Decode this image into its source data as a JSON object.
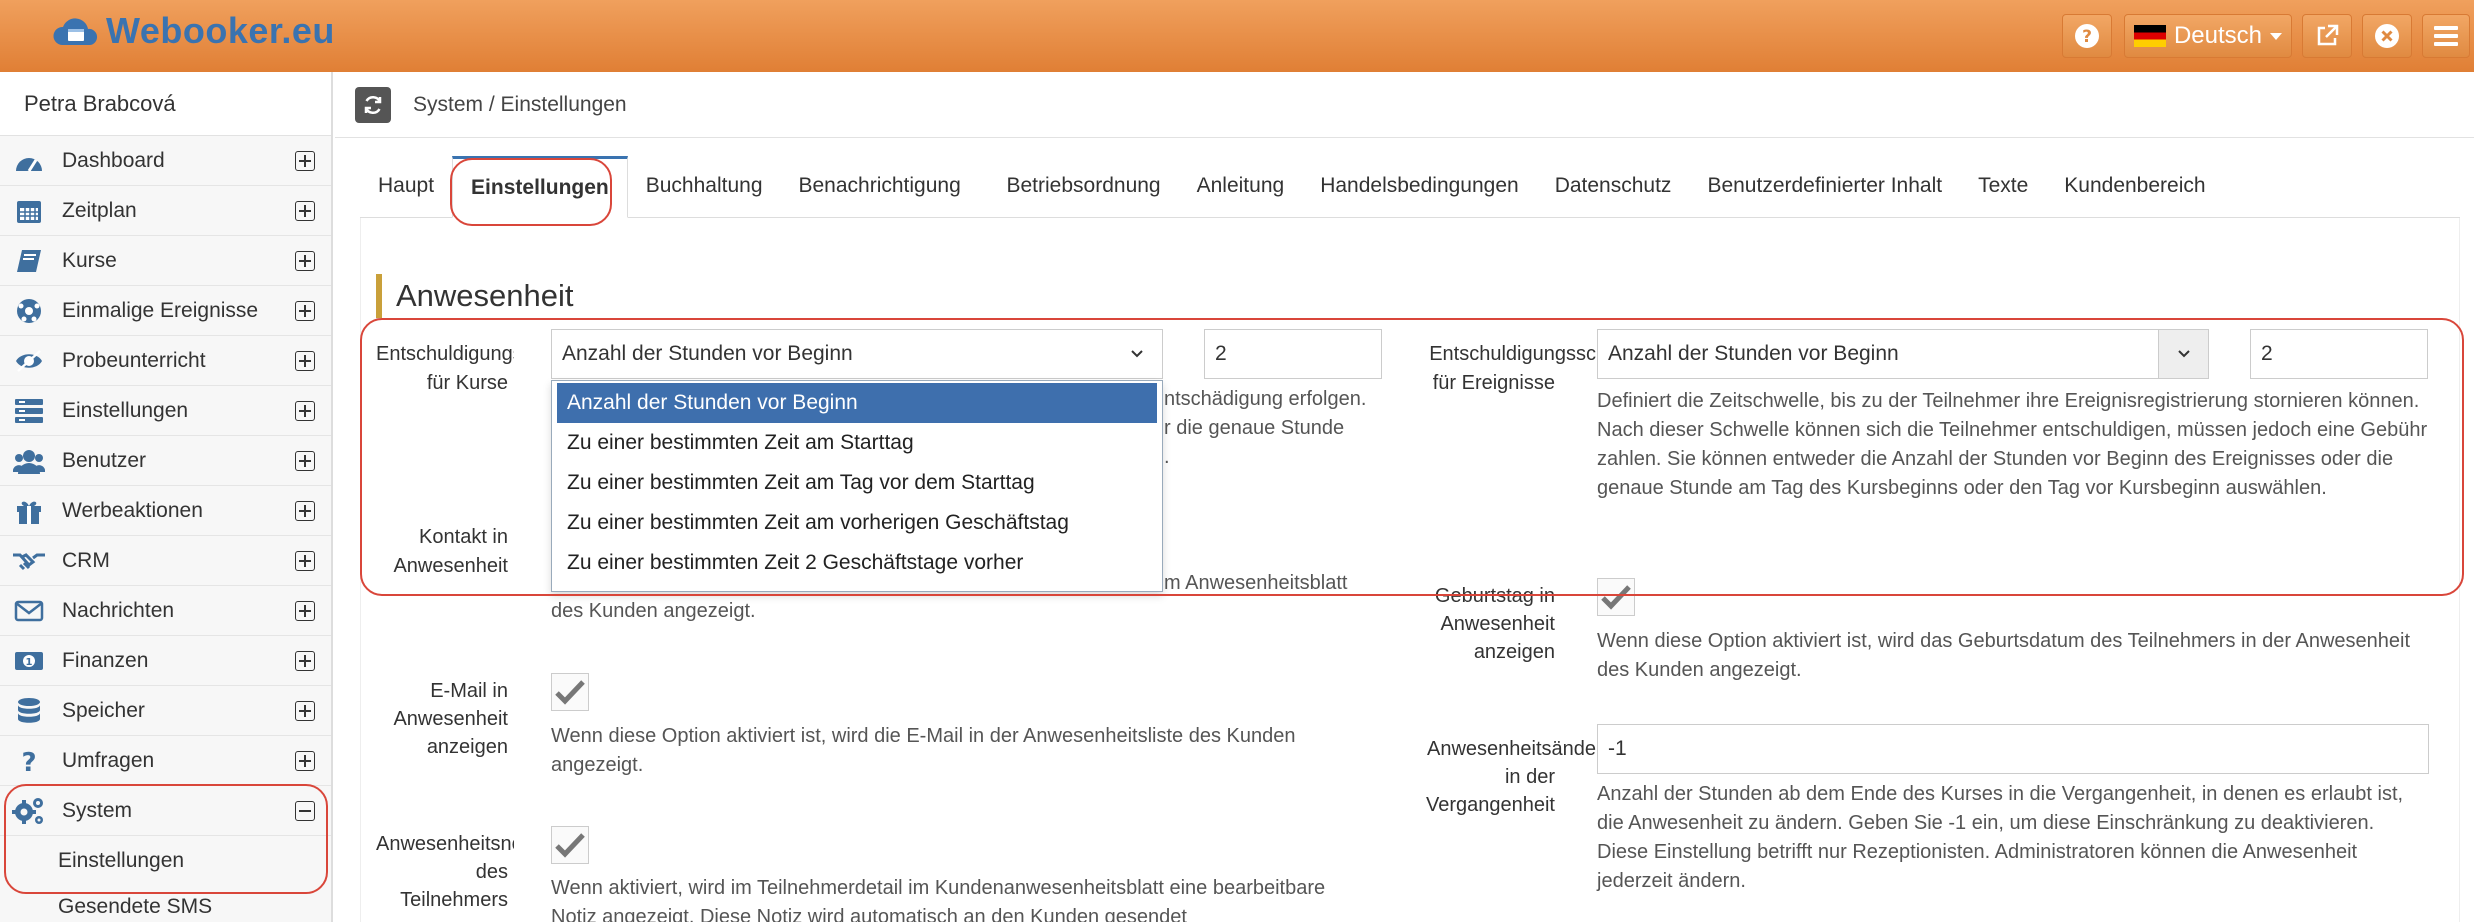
{
  "app": {
    "logo_text": "Webooker.eu"
  },
  "topbar": {
    "language": "Deutsch",
    "icons": [
      "help-icon",
      "external-link-icon",
      "close-icon",
      "menu-icon"
    ]
  },
  "sidebar": {
    "user": "Petra Brabcová",
    "items": [
      {
        "label": "Dashboard",
        "icon": "dashboard-icon"
      },
      {
        "label": "Zeitplan",
        "icon": "calendar-icon"
      },
      {
        "label": "Kurse",
        "icon": "book-icon"
      },
      {
        "label": "Einmalige Ereignisse",
        "icon": "ball-icon"
      },
      {
        "label": "Probeunterricht",
        "icon": "eye-icon"
      },
      {
        "label": "Einstellungen",
        "icon": "list-icon"
      },
      {
        "label": "Benutzer",
        "icon": "users-icon"
      },
      {
        "label": "Werbeaktionen",
        "icon": "gift-icon"
      },
      {
        "label": "CRM",
        "icon": "handshake-icon"
      },
      {
        "label": "Nachrichten",
        "icon": "envelope-icon"
      },
      {
        "label": "Finanzen",
        "icon": "money-icon"
      },
      {
        "label": "Speicher",
        "icon": "database-icon"
      },
      {
        "label": "Umfragen",
        "icon": "question-icon"
      },
      {
        "label": "System",
        "icon": "gears-icon"
      }
    ],
    "submenu": [
      "Einstellungen",
      "Gesendete SMS"
    ]
  },
  "breadcrumb": "System / Einstellungen",
  "tabs": [
    "Haupt",
    "Einstellungen",
    "Buchhaltung",
    "Benachrichtigung",
    "Betriebsordnung",
    "Anleitung",
    "Handelsbedingungen",
    "Datenschutz",
    "Benutzerdefinierter Inhalt",
    "Texte",
    "Kundenbereich"
  ],
  "section": {
    "title": "Anwesenheit"
  },
  "left": {
    "excuse_label_1": "Entschuldigungssc",
    "excuse_label_2": "für Kurse",
    "excuse_select": "Anzahl der Stunden vor Beginn",
    "excuse_value": "2",
    "excuse_help_1": "ntschädigung erfolgen.",
    "excuse_help_2": "r die genaue Stunde",
    "excuse_help_3": ".",
    "contact_label_1": "Kontakt in",
    "contact_label_2": "Anwesenheit",
    "contact_help_1": "m Anwesenheitsblatt",
    "contact_help_2": "des Kunden angezeigt.",
    "email_label_1": "E-Mail in",
    "email_label_2": "Anwesenheit",
    "email_label_3": "anzeigen",
    "email_help": "Wenn diese Option aktiviert ist, wird die E-Mail in der Anwesenheitsliste des Kunden angezeigt.",
    "note_label_1": "Anwesenheitsnotiz",
    "note_label_2": "des",
    "note_label_3": "Teilnehmers",
    "note_help": "Wenn aktiviert, wird im Teilnehmerdetail im Kundenanwesenheitsblatt eine bearbeitbare Notiz angezeigt. Diese Notiz wird automatisch an den Kunden gesendet"
  },
  "dropdown": {
    "options": [
      "Anzahl der Stunden vor Beginn",
      "Zu einer bestimmten Zeit am Starttag",
      "Zu einer bestimmten Zeit am Tag vor dem Starttag",
      "Zu einer bestimmten Zeit am vorherigen Geschäftstag",
      "Zu einer bestimmten Zeit 2 Geschäftstage vorher"
    ]
  },
  "right": {
    "excuse_label_1": "Entschuldigungssc",
    "excuse_label_2": "für Ereignisse",
    "excuse_select": "Anzahl der Stunden vor Beginn",
    "excuse_value": "2",
    "excuse_help": "Definiert die Zeitschwelle, bis zu der Teilnehmer ihre Ereignisregistrierung stornieren können. Nach dieser Schwelle können sich die Teilnehmer entschuldigen, müssen jedoch eine Gebühr zahlen. Sie können entweder die Anzahl der Stunden vor Beginn des Ereignisses oder die genaue Stunde am Tag des Kursbeginns oder den Tag vor Kursbeginn auswählen.",
    "birthday_label_1": "Geburtstag in",
    "birthday_label_2": "Anwesenheit",
    "birthday_label_3": "anzeigen",
    "birthday_help": "Wenn diese Option aktiviert ist, wird das Geburtsdatum des Teilnehmers in der Anwesenheit des Kunden angezeigt.",
    "change_label_1": "Anwesenheitsände",
    "change_label_2": "in der",
    "change_label_3": "Vergangenheit",
    "change_value": "-1",
    "change_help": "Anzahl der Stunden ab dem Ende des Kurses in die Vergangenheit, in denen es erlaubt ist, die Anwesenheit zu ändern. Geben Sie -1 ein, um diese Einschränkung zu deaktivieren. Diese Einstellung betrifft nur Rezeptionisten. Administratoren können die Anwesenheit jederzeit ändern."
  }
}
